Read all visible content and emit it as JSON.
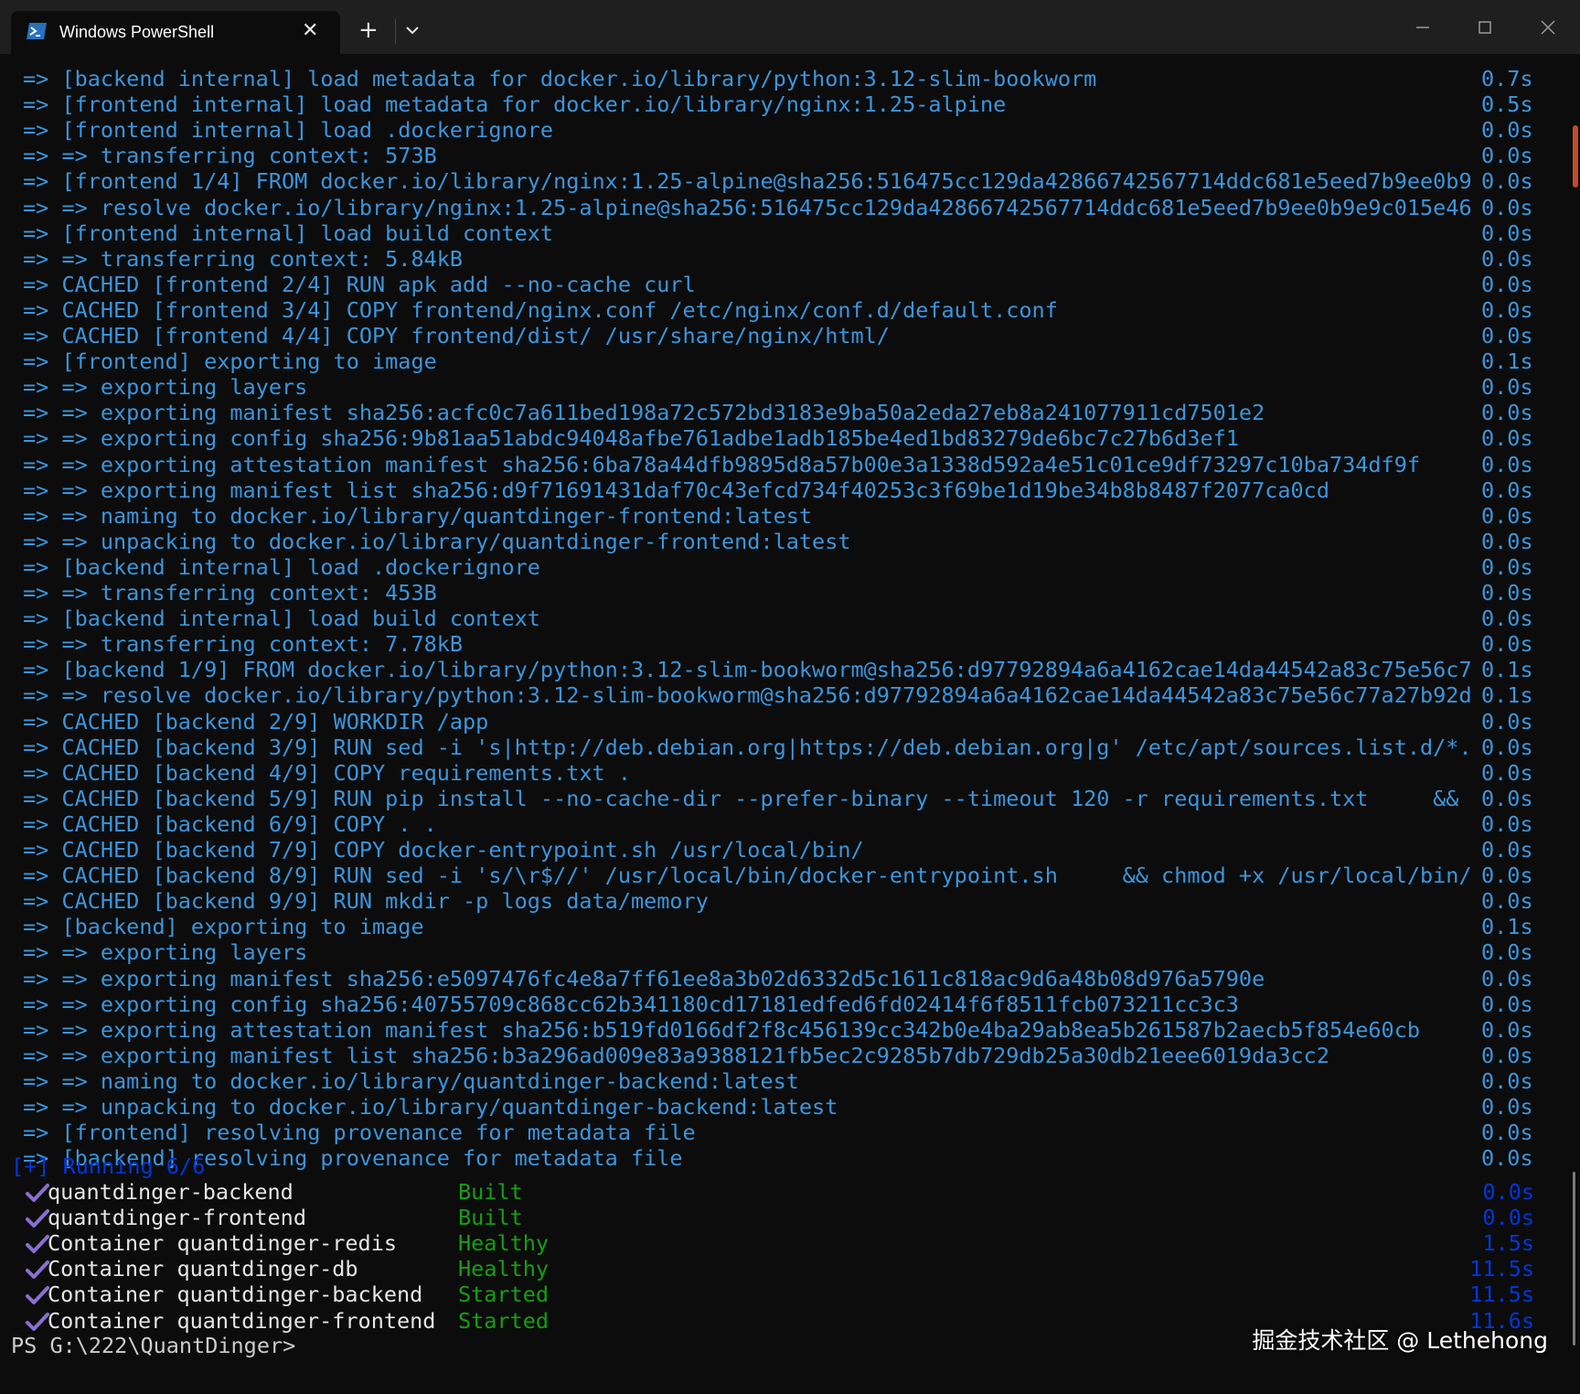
{
  "window": {
    "tab_title": "Windows PowerShell",
    "icons": {
      "tab_icon": "powershell-icon",
      "close": "close-icon",
      "new_tab": "plus-icon",
      "dropdown": "chevron-down-icon",
      "minimize": "minimize-icon",
      "maximize": "maximize-icon",
      "window_close": "close-icon"
    },
    "colors": {
      "titlebar": "#1f1f1f",
      "background": "#0c0c0c",
      "cyan_text": "#3a96dd",
      "blue_text": "#0037da",
      "green_text": "#13a10e",
      "check": "#8a6fd4",
      "foreground": "#cccccc"
    }
  },
  "terminal": {
    "log": [
      {
        "text": "=> [backend internal] load metadata for docker.io/library/python:3.12-slim-bookworm",
        "time": "0.7s"
      },
      {
        "text": "=> [frontend internal] load metadata for docker.io/library/nginx:1.25-alpine",
        "time": "0.5s"
      },
      {
        "text": "=> [frontend internal] load .dockerignore",
        "time": "0.0s"
      },
      {
        "text": "=> => transferring context: 573B",
        "time": "0.0s"
      },
      {
        "text": "=> [frontend 1/4] FROM docker.io/library/nginx:1.25-alpine@sha256:516475cc129da42866742567714ddc681e5eed7b9ee0b9",
        "time": "0.0s"
      },
      {
        "text": "=> => resolve docker.io/library/nginx:1.25-alpine@sha256:516475cc129da42866742567714ddc681e5eed7b9ee0b9e9c015e46",
        "time": "0.0s"
      },
      {
        "text": "=> [frontend internal] load build context",
        "time": "0.0s"
      },
      {
        "text": "=> => transferring context: 5.84kB",
        "time": "0.0s"
      },
      {
        "text": "=> CACHED [frontend 2/4] RUN apk add --no-cache curl",
        "time": "0.0s"
      },
      {
        "text": "=> CACHED [frontend 3/4] COPY frontend/nginx.conf /etc/nginx/conf.d/default.conf",
        "time": "0.0s"
      },
      {
        "text": "=> CACHED [frontend 4/4] COPY frontend/dist/ /usr/share/nginx/html/",
        "time": "0.0s"
      },
      {
        "text": "=> [frontend] exporting to image",
        "time": "0.1s"
      },
      {
        "text": "=> => exporting layers",
        "time": "0.0s"
      },
      {
        "text": "=> => exporting manifest sha256:acfc0c7a611bed198a72c572bd3183e9ba50a2eda27eb8a241077911cd7501e2",
        "time": "0.0s"
      },
      {
        "text": "=> => exporting config sha256:9b81aa51abdc94048afbe761adbe1adb185be4ed1bd83279de6bc7c27b6d3ef1",
        "time": "0.0s"
      },
      {
        "text": "=> => exporting attestation manifest sha256:6ba78a44dfb9895d8a57b00e3a1338d592a4e51c01ce9df73297c10ba734df9f",
        "time": "0.0s"
      },
      {
        "text": "=> => exporting manifest list sha256:d9f71691431daf70c43efcd734f40253c3f69be1d19be34b8b8487f2077ca0cd",
        "time": "0.0s"
      },
      {
        "text": "=> => naming to docker.io/library/quantdinger-frontend:latest",
        "time": "0.0s"
      },
      {
        "text": "=> => unpacking to docker.io/library/quantdinger-frontend:latest",
        "time": "0.0s"
      },
      {
        "text": "=> [backend internal] load .dockerignore",
        "time": "0.0s"
      },
      {
        "text": "=> => transferring context: 453B",
        "time": "0.0s"
      },
      {
        "text": "=> [backend internal] load build context",
        "time": "0.0s"
      },
      {
        "text": "=> => transferring context: 7.78kB",
        "time": "0.0s"
      },
      {
        "text": "=> [backend 1/9] FROM docker.io/library/python:3.12-slim-bookworm@sha256:d97792894a6a4162cae14da44542a83c75e56c7",
        "time": "0.1s"
      },
      {
        "text": "=> => resolve docker.io/library/python:3.12-slim-bookworm@sha256:d97792894a6a4162cae14da44542a83c75e56c77a27b92d",
        "time": "0.1s"
      },
      {
        "text": "=> CACHED [backend 2/9] WORKDIR /app",
        "time": "0.0s"
      },
      {
        "text": "=> CACHED [backend 3/9] RUN sed -i 's|http://deb.debian.org|https://deb.debian.org|g' /etc/apt/sources.list.d/*.",
        "time": "0.0s"
      },
      {
        "text": "=> CACHED [backend 4/9] COPY requirements.txt .",
        "time": "0.0s"
      },
      {
        "text": "=> CACHED [backend 5/9] RUN pip install --no-cache-dir --prefer-binary --timeout 120 -r requirements.txt     &&",
        "time": "0.0s"
      },
      {
        "text": "=> CACHED [backend 6/9] COPY . .",
        "time": "0.0s"
      },
      {
        "text": "=> CACHED [backend 7/9] COPY docker-entrypoint.sh /usr/local/bin/",
        "time": "0.0s"
      },
      {
        "text": "=> CACHED [backend 8/9] RUN sed -i 's/\\r$//' /usr/local/bin/docker-entrypoint.sh     && chmod +x /usr/local/bin/",
        "time": "0.0s"
      },
      {
        "text": "=> CACHED [backend 9/9] RUN mkdir -p logs data/memory",
        "time": "0.0s"
      },
      {
        "text": "=> [backend] exporting to image",
        "time": "0.1s"
      },
      {
        "text": "=> => exporting layers",
        "time": "0.0s"
      },
      {
        "text": "=> => exporting manifest sha256:e5097476fc4e8a7ff61ee8a3b02d6332d5c1611c818ac9d6a48b08d976a5790e",
        "time": "0.0s"
      },
      {
        "text": "=> => exporting config sha256:40755709c868cc62b341180cd17181edfed6fd02414f6f8511fcb073211cc3c3",
        "time": "0.0s"
      },
      {
        "text": "=> => exporting attestation manifest sha256:b519fd0166df2f8c456139cc342b0e4ba29ab8ea5b261587b2aecb5f854e60cb",
        "time": "0.0s"
      },
      {
        "text": "=> => exporting manifest list sha256:b3a296ad009e83a9388121fb5ec2c9285b7db729db25a30db21eee6019da3cc2",
        "time": "0.0s"
      },
      {
        "text": "=> => naming to docker.io/library/quantdinger-backend:latest",
        "time": "0.0s"
      },
      {
        "text": "=> => unpacking to docker.io/library/quantdinger-backend:latest",
        "time": "0.0s"
      },
      {
        "text": "=> [frontend] resolving provenance for metadata file",
        "time": "0.0s"
      },
      {
        "text": "=> [backend] resolving provenance for metadata file",
        "time": "0.0s"
      }
    ],
    "running": "[+] Running 6/6",
    "services": [
      {
        "name": "quantdinger-backend",
        "status": "Built",
        "time": "0.0s"
      },
      {
        "name": "quantdinger-frontend",
        "status": "Built",
        "time": "0.0s"
      },
      {
        "name": "Container quantdinger-redis",
        "status": "Healthy",
        "time": "1.5s"
      },
      {
        "name": "Container quantdinger-db",
        "status": "Healthy",
        "time": "11.5s"
      },
      {
        "name": "Container quantdinger-backend",
        "status": "Started",
        "time": "11.5s"
      },
      {
        "name": "Container quantdinger-frontend",
        "status": "Started",
        "time": "11.6s"
      }
    ],
    "check_icon": "checkmark-icon",
    "prompt": "PS G:\\222\\QuantDinger>"
  },
  "watermark": "掘金技术社区 @ Lethehong"
}
